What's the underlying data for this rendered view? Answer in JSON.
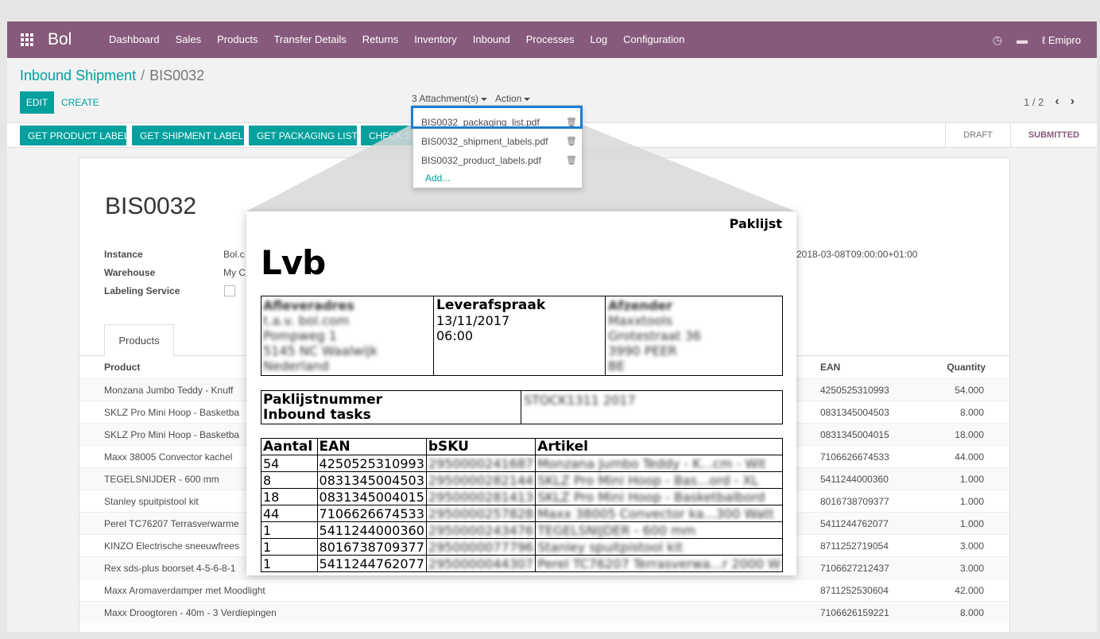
{
  "nav": {
    "brand": "Bol",
    "menu": [
      "Dashboard",
      "Sales",
      "Products",
      "Transfer Details",
      "Returns",
      "Inventory",
      "Inbound",
      "Processes",
      "Log",
      "Configuration"
    ],
    "user": "Emipro"
  },
  "breadcrumb": {
    "parent": "Inbound Shipment",
    "separator": "/",
    "current": "BIS0032"
  },
  "buttons": {
    "edit": "EDIT",
    "create": "CREATE"
  },
  "attachments": {
    "label": "3 Attachment(s)",
    "action": "Action",
    "files": [
      "BIS0032_packaging_list.pdf",
      "BIS0032_shipment_labels.pdf",
      "BIS0032_product_labels.pdf"
    ],
    "add": "Add..."
  },
  "pager": {
    "text": "1 / 2"
  },
  "header_buttons": [
    "GET PRODUCT LABEL",
    "GET SHIPMENT LABEL",
    "GET PACKAGING LIST",
    "CHECK SH"
  ],
  "statusbar": {
    "draft": "DRAFT",
    "submitted": "SUBMITTED"
  },
  "record": {
    "title": "BIS0032",
    "fields": {
      "instance_label": "Instance",
      "instance_value": "Bol.c",
      "warehouse_label": "Warehouse",
      "warehouse_value": "My C",
      "labeling_label": "Labeling Service"
    },
    "arrival_value": "2018-03-08T09:00:00+01:00",
    "tab": "Products",
    "columns": {
      "product": "Product",
      "ean": "EAN",
      "quantity": "Quantity"
    },
    "rows": [
      {
        "product": "Monzana Jumbo Teddy - Knuff",
        "ean": "4250525310993",
        "qty": "54.000"
      },
      {
        "product": "SKLZ Pro Mini Hoop - Basketba",
        "ean": "0831345004503",
        "qty": "8.000"
      },
      {
        "product": "SKLZ Pro Mini Hoop - Basketba",
        "ean": "0831345004015",
        "qty": "18.000"
      },
      {
        "product": "Maxx 38005 Convector kachel",
        "ean": "7106626674533",
        "qty": "44.000"
      },
      {
        "product": "TEGELSNIJDER - 600 mm",
        "ean": "5411244000360",
        "qty": "1.000"
      },
      {
        "product": "Stanley spuitpistool kit",
        "ean": "8016738709377",
        "qty": "1.000"
      },
      {
        "product": "Perel TC76207 Terrasverwarme",
        "ean": "5411244762077",
        "qty": "1.000"
      },
      {
        "product": "KINZO Electrische sneeuwfrees",
        "ean": "8711252719054",
        "qty": "3.000"
      },
      {
        "product": "Rex sds-plus boorset 4-5-6-8-1",
        "ean": "7106627212437",
        "qty": "3.000"
      },
      {
        "product": "Maxx Aromaverdamper met Moodlight",
        "ean": "8711252530604",
        "qty": "42.000"
      },
      {
        "product": "Maxx Droogtoren - 40m - 3 Verdiepingen",
        "ean": "7106626159221",
        "qty": "8.000"
      }
    ]
  },
  "pdf": {
    "title": "Paklijst",
    "big": "Lvb",
    "afleveradres": [
      "Afleveradres",
      "t.a.v. bol.com",
      "Pompweg 1",
      "5145 NC Waalwijk",
      "Nederland"
    ],
    "leverafspraak_label": "Leverafspraak",
    "leverafspraak_date": "13/11/2017",
    "leverafspraak_time": "06:00",
    "afzender": [
      "Afzender",
      "Maxxtools",
      "Grotestraat 36",
      "3990 PEER",
      "BE"
    ],
    "paklijst_label": "Paklijstnummer",
    "inbound_label": "Inbound tasks",
    "paklijst_value": "STOCK1311 2017",
    "table_headers": [
      "Aantal",
      "EAN",
      "bSKU",
      "Artikel"
    ],
    "table_rows": [
      {
        "aantal": "54",
        "ean": "4250525310993",
        "bsku": "2950000241687",
        "artikel": "Monzana Jumbo Teddy - K...cm - Wit"
      },
      {
        "aantal": "8",
        "ean": "0831345004503",
        "bsku": "2950000282144",
        "artikel": "SKLZ Pro Mini Hoop - Bas...ord - XL"
      },
      {
        "aantal": "18",
        "ean": "0831345004015",
        "bsku": "2950000281413",
        "artikel": "SKLZ Pro Mini Hoop - Basketbalbord"
      },
      {
        "aantal": "44",
        "ean": "7106626674533",
        "bsku": "2950000257828",
        "artikel": "Maxx 38005 Convector ka...300 Watt"
      },
      {
        "aantal": "1",
        "ean": "5411244000360",
        "bsku": "2950000243476",
        "artikel": "TEGELSNIJDER - 600 mm"
      },
      {
        "aantal": "1",
        "ean": "8016738709377",
        "bsku": "2950000077796",
        "artikel": "Stanley spuitpistool kit"
      },
      {
        "aantal": "1",
        "ean": "5411244762077",
        "bsku": "2950000044307",
        "artikel": "Perel TC76207 Terrasverwa...r 2000 W"
      }
    ]
  }
}
